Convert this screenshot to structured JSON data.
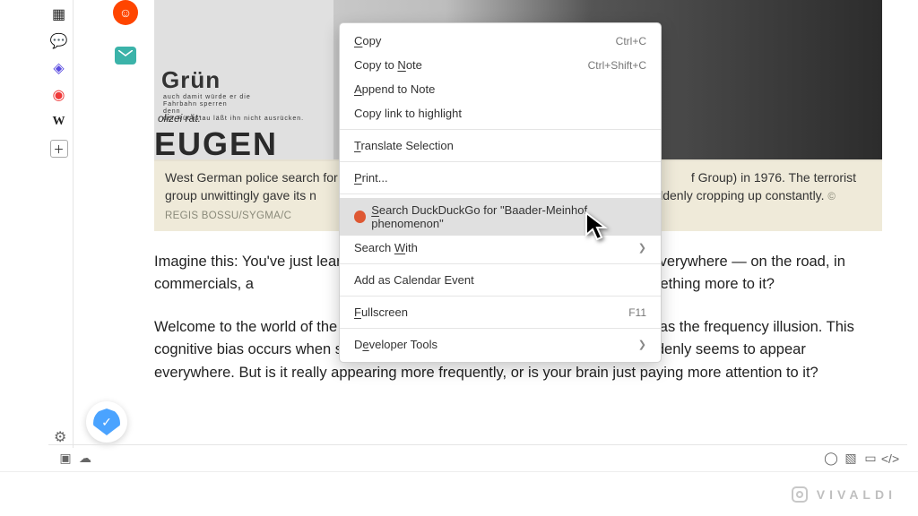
{
  "sidebar": {
    "icons": [
      "window",
      "chat",
      "mastodon",
      "vivaldi",
      "wikipedia",
      "add"
    ]
  },
  "social": {
    "mail_icon": "mail"
  },
  "article": {
    "poster": {
      "grun": "Grün",
      "polizei": "olizei rät:",
      "eugen": "EUGEN"
    },
    "caption_pre": "West German police search for nine",
    "caption_post": "f Group) in 1976. The terrorist group unwittingly gave its n",
    "caption_tail": "suddenly cropping up constantly.",
    "credit": "© REGIS BOSSU/SYGMA/C",
    "p1a": "Imagine this: You've just learn",
    "p1b": "ing it everywhere — on the road, in commercials, a",
    "p1c": "ncidence, or is there something more to it?",
    "p2a": "Welcome to the world of the ",
    "selected": "Baader-Meinhof phenomenon",
    "p2b": ", otherwise known as the frequency illusion. This cognitive bias occurs when something you've noticed or recently learned suddenly seems to appear everywhere. But is it really appearing more frequently, or is your brain just paying more attention to it?"
  },
  "ctx": {
    "copy": "Copy",
    "copy_sc": "Ctrl+C",
    "copy_to_note": "Copy to Note",
    "copy_to_note_sc": "Ctrl+Shift+C",
    "append": "Append to Note",
    "copy_link": "Copy link to highlight",
    "translate": "Translate Selection",
    "print": "Print...",
    "search_ddg": "Search DuckDuckGo for \"Baader-Meinhof phenomenon\"",
    "search_with": "Search With",
    "calendar": "Add as Calendar Event",
    "fullscreen": "Fullscreen",
    "fullscreen_sc": "F11",
    "devtools": "Developer Tools"
  },
  "brand": "VIVALDI"
}
